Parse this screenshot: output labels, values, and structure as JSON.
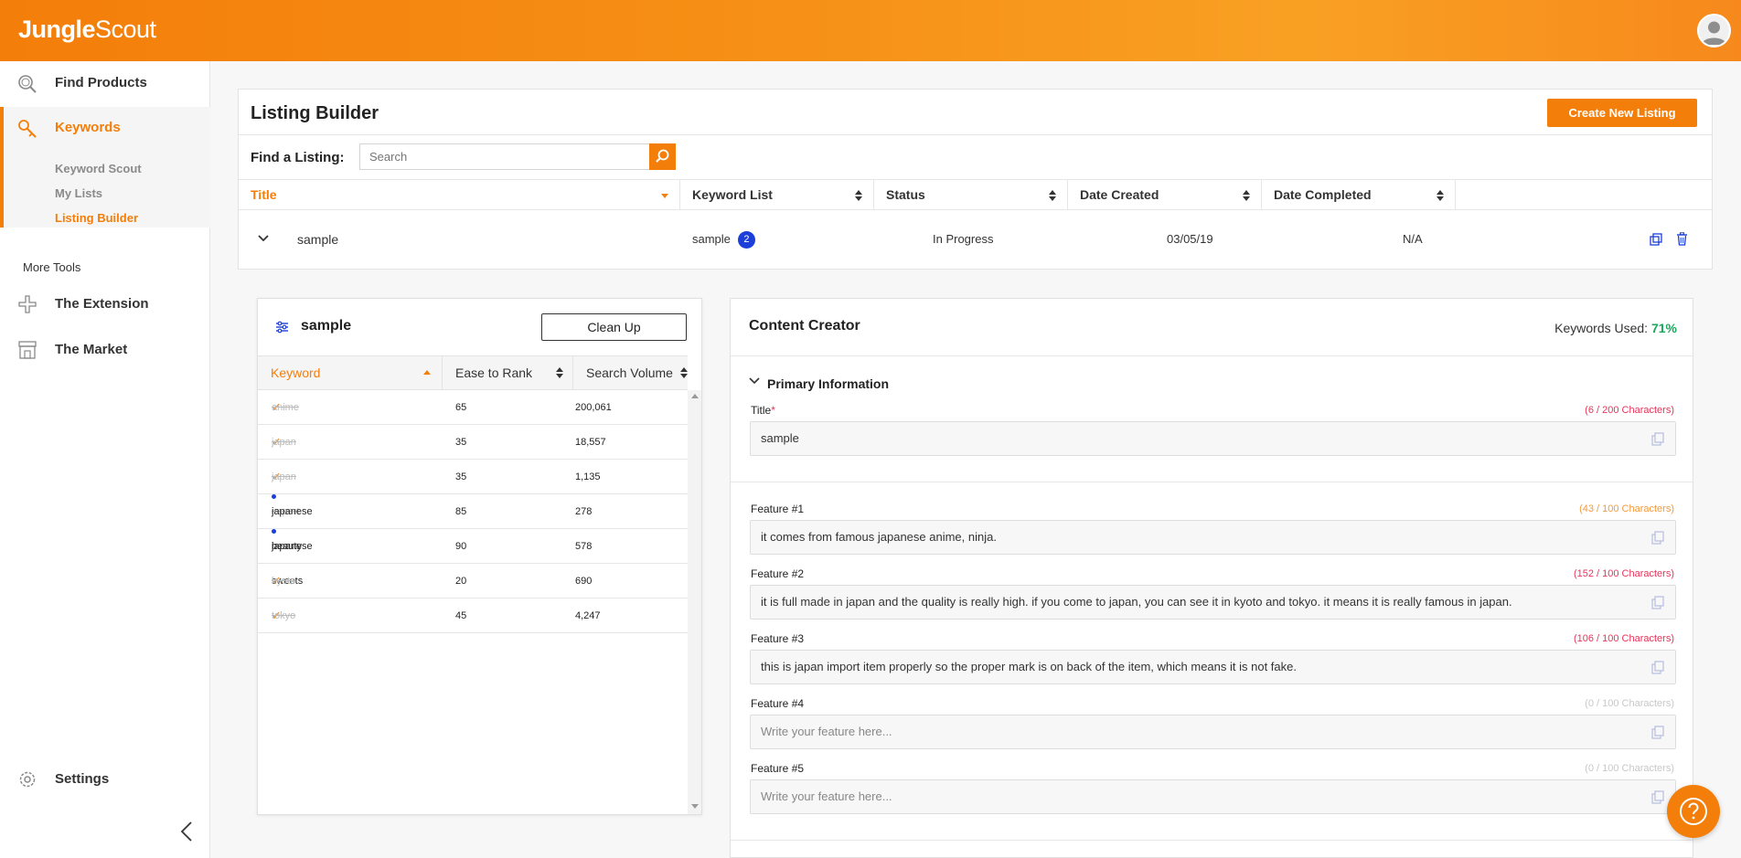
{
  "app": {
    "logo_bold": "Jungle",
    "logo_thin": "Scout"
  },
  "sidebar": {
    "find_products": "Find Products",
    "keywords": "Keywords",
    "sub_items": [
      "Keyword Scout",
      "My Lists",
      "Listing Builder"
    ],
    "more_tools": "More Tools",
    "extension": "The Extension",
    "market": "The Market",
    "settings": "Settings"
  },
  "listing_builder": {
    "title": "Listing Builder",
    "create_button": "Create New Listing",
    "find_label": "Find a Listing:",
    "search_placeholder": "Search",
    "columns": [
      "Title",
      "Keyword List",
      "Status",
      "Date Created",
      "Date Completed"
    ],
    "row": {
      "title": "sample",
      "keyword_list": "sample",
      "keyword_count": "2",
      "status": "In Progress",
      "date_created": "03/05/19",
      "date_completed": "N/A"
    }
  },
  "keyword_panel": {
    "title": "sample",
    "cleanup_button": "Clean Up",
    "columns": [
      "Keyword",
      "Ease to Rank",
      "Search Volume"
    ],
    "rows": [
      {
        "keyword": "anime",
        "ease": "65",
        "volume": "200,061",
        "used": true
      },
      {
        "keyword": "japan",
        "ease": "35",
        "volume": "18,557",
        "used": true
      },
      {
        "keyword": "japan import",
        "ease": "35",
        "volume": "1,135",
        "used": true
      },
      {
        "keyword": "japanese beauty",
        "ease": "85",
        "volume": "278",
        "used": false
      },
      {
        "keyword": "japanese sweets",
        "ease": "90",
        "volume": "578",
        "used": false
      },
      {
        "keyword": "kyoto",
        "ease": "20",
        "volume": "690",
        "used": true
      },
      {
        "keyword": "tokyo",
        "ease": "45",
        "volume": "4,247",
        "used": true
      }
    ]
  },
  "content_creator": {
    "title": "Content Creator",
    "keywords_used_label": "Keywords Used:",
    "keywords_used_value": "71%",
    "primary_info": "Primary Information",
    "title_field": {
      "label": "Title",
      "required": "*",
      "count": "(6 / 200 Characters)",
      "value": "sample"
    },
    "features": [
      {
        "label": "Feature #1",
        "count": "(43 / 100 Characters)",
        "value": "it comes from famous japanese anime, ninja.",
        "placeholder": ""
      },
      {
        "label": "Feature #2",
        "count": "(152 / 100 Characters)",
        "value": "it is full made in japan and the quality is really high. if you come to japan, you can see it in kyoto and tokyo. it means it is really famous in japan.",
        "placeholder": ""
      },
      {
        "label": "Feature #3",
        "count": "(106 / 100 Characters)",
        "value": "this is japan import item properly so the proper mark is on back of the item, which means it is not fake.",
        "placeholder": ""
      },
      {
        "label": "Feature #4",
        "count": "(0 / 100 Characters)",
        "value": "",
        "placeholder": "Write your feature here..."
      },
      {
        "label": "Feature #5",
        "count": "(0 / 100 Characters)",
        "value": "",
        "placeholder": "Write your feature here..."
      }
    ]
  },
  "colors": {
    "accent": "#f47e0a",
    "blue": "#1b3fd8",
    "green": "#1aa85c",
    "red": "#e8345a"
  }
}
